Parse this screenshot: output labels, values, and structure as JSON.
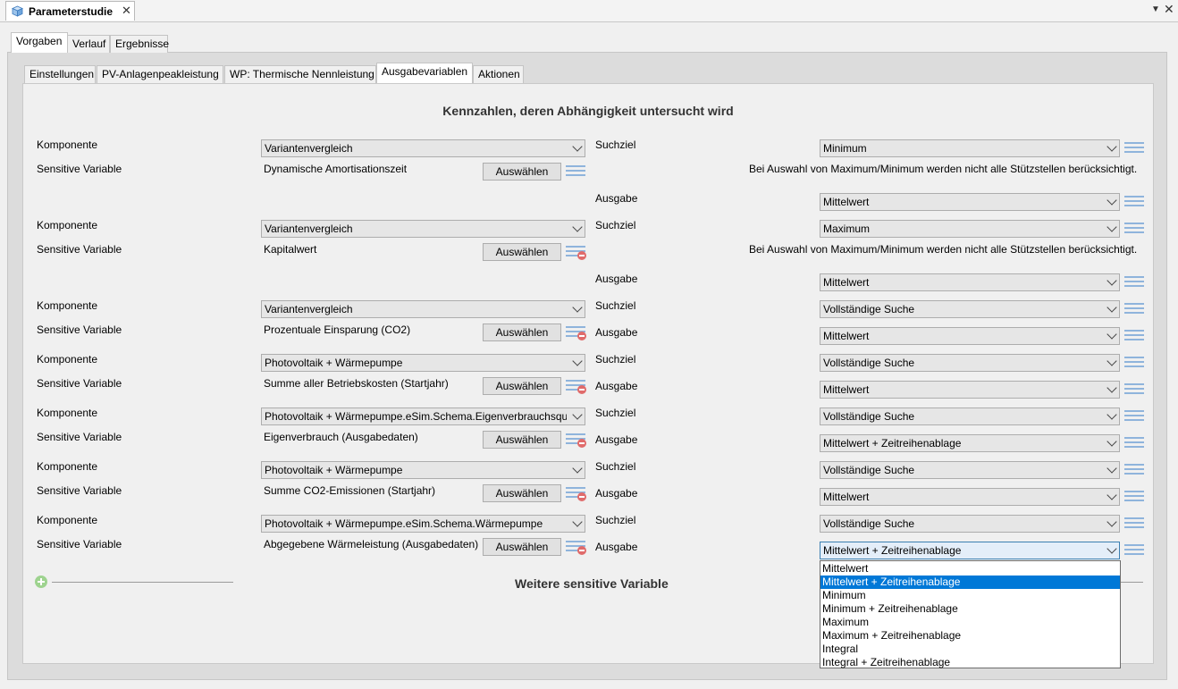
{
  "window": {
    "title": "Parameterstudie",
    "close_glyph": "✕",
    "menu_glyph": "▼",
    "close_all_glyph": "✕"
  },
  "main_tabs": [
    "Vorgaben",
    "Verlauf",
    "Ergebnisse"
  ],
  "sub_tabs": [
    "Einstellungen",
    "PV-Anlagenpeakleistung",
    "WP: Thermische Nennleistung",
    "Ausgabevariablen",
    "Aktionen"
  ],
  "heading": "Kennzahlen, deren Abhängigkeit untersucht wird",
  "labels": {
    "komponente": "Komponente",
    "sensitive_variable": "Sensitive Variable",
    "suchziel": "Suchziel",
    "ausgabe": "Ausgabe",
    "auswaehlen": "Auswählen",
    "note": "Bei Auswahl von Maximum/Minimum werden nicht alle Stützstellen berücksichtigt."
  },
  "groups": [
    {
      "komponente": "Variantenvergleich",
      "variable": "Dynamische Amortisationszeit",
      "suchziel": "Minimum",
      "ausgabe": "Mittelwert"
    },
    {
      "komponente": "Variantenvergleich",
      "variable": "Kapitalwert",
      "suchziel": "Maximum",
      "ausgabe": "Mittelwert"
    },
    {
      "komponente": "Variantenvergleich",
      "variable": "Prozentuale Einsparung (CO2)",
      "suchziel": "Vollständige Suche",
      "ausgabe": "Mittelwert"
    },
    {
      "komponente": "Photovoltaik + Wärmepumpe",
      "variable": "Summe aller Betriebskosten (Startjahr)",
      "suchziel": "Vollständige Suche",
      "ausgabe": "Mittelwert"
    },
    {
      "komponente": "Photovoltaik + Wärmepumpe.eSim.Schema.Eigenverbrauchsquote",
      "variable": "Eigenverbrauch (Ausgabedaten)",
      "suchziel": "Vollständige Suche",
      "ausgabe": "Mittelwert + Zeitreihenablage"
    },
    {
      "komponente": "Photovoltaik + Wärmepumpe",
      "variable": "Summe CO2-Emissionen (Startjahr)",
      "suchziel": "Vollständige Suche",
      "ausgabe": "Mittelwert"
    },
    {
      "komponente": "Photovoltaik + Wärmepumpe.eSim.Schema.Wärmepumpe",
      "variable": "Abgegebene Wärmeleistung (Ausgabedaten)",
      "suchziel": "Vollständige Suche",
      "ausgabe": "Mittelwert + Zeitreihenablage"
    }
  ],
  "dropdown_options": [
    "Mittelwert",
    "Mittelwert + Zeitreihenablage",
    "Minimum",
    "Minimum + Zeitreihenablage",
    "Maximum",
    "Maximum + Zeitreihenablage",
    "Integral",
    "Integral + Zeitreihenablage"
  ],
  "dropdown_selected": "Mittelwert + Zeitreihenablage",
  "footer_label": "Weitere sensitive Variable"
}
